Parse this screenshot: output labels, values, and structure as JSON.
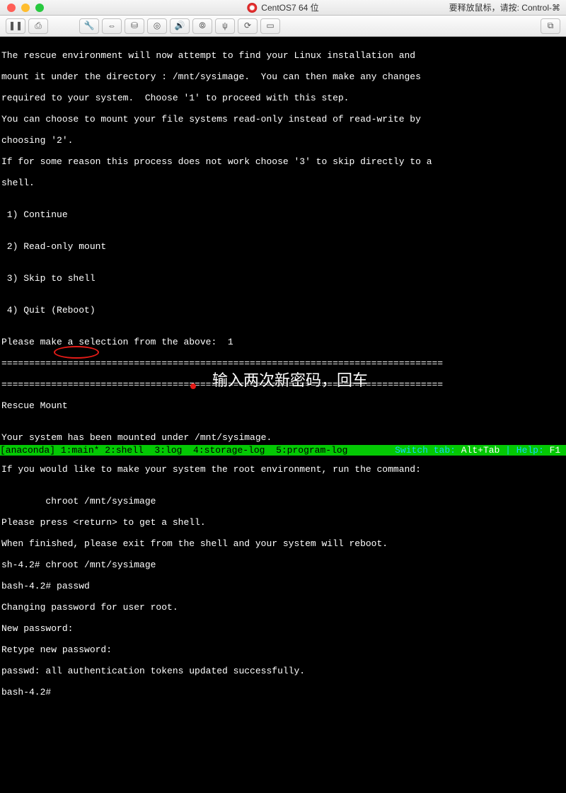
{
  "titlebar": {
    "title": "CentOS7 64 位",
    "hint": "要释放鼠标，请按: Control-⌘"
  },
  "toolbar": {
    "pause": "❚❚",
    "snapshot": "⎙",
    "wrench": "🔧",
    "network": "⇔",
    "hdd": "⛁",
    "cd": "◎",
    "sound": "🔊",
    "camera": "⦾",
    "usb": "ψ",
    "sync": "⟳",
    "monitor": "▭",
    "fullscreen_group": "⧉"
  },
  "terminal": {
    "l1": "The rescue environment will now attempt to find your Linux installation and",
    "l2": "mount it under the directory : /mnt/sysimage.  You can then make any changes",
    "l3": "required to your system.  Choose '1' to proceed with this step.",
    "l4": "You can choose to mount your file systems read-only instead of read-write by",
    "l5": "choosing '2'.",
    "l6": "If for some reason this process does not work choose '3' to skip directly to a",
    "l7": "shell.",
    "l8": "",
    "l9": " 1) Continue",
    "l10": "",
    "l11": " 2) Read-only mount",
    "l12": "",
    "l13": " 3) Skip to shell",
    "l14": "",
    "l15": " 4) Quit (Reboot)",
    "l16": "",
    "l17": "Please make a selection from the above:  1",
    "l18": "================================================================================",
    "l19": "================================================================================",
    "l20": "Rescue Mount",
    "l21": "",
    "l22": "Your system has been mounted under /mnt/sysimage.",
    "l23": "",
    "l24": "If you would like to make your system the root environment, run the command:",
    "l25": "",
    "l26": "        chroot /mnt/sysimage",
    "l27": "Please press <return> to get a shell.",
    "l28": "When finished, please exit from the shell and your system will reboot.",
    "l29": "sh-4.2# chroot /mnt/sysimage",
    "l30": "bash-4.2# passwd",
    "l31": "Changing password for user root.",
    "l32": "New password:",
    "l33": "Retype new password:",
    "l34": "passwd: all authentication tokens updated successfully.",
    "l35": "bash-4.2# "
  },
  "annotation": {
    "text": "输入两次新密码，回车"
  },
  "statusbar": {
    "left": "[anaconda] 1:main* 2:shell  3:log  4:storage-log  5:program-log ",
    "right_prefix": " Switch tab: ",
    "right_k1": "Alt+Tab",
    "right_mid": " | Help: ",
    "right_k2": "F1",
    "right_suffix": " "
  }
}
